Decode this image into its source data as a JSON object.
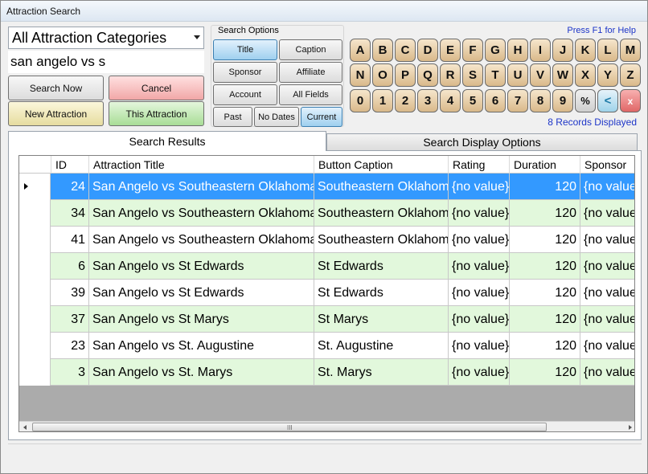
{
  "window": {
    "title": "Attraction Search"
  },
  "category_select": {
    "value": "All Attraction Categories"
  },
  "search": {
    "value": "san angelo vs s"
  },
  "actions": {
    "search_now": "Search Now",
    "cancel": "Cancel",
    "new_attraction": "New Attraction",
    "this_attraction": "This Attraction"
  },
  "search_options": {
    "legend": "Search Options",
    "title": "Title",
    "caption": "Caption",
    "sponsor": "Sponsor",
    "affiliate": "Affiliate",
    "account": "Account",
    "all_fields": "All Fields",
    "past": "Past",
    "no_dates": "No Dates",
    "current": "Current",
    "selected": [
      "Title",
      "Current"
    ]
  },
  "help_text": "Press F1 for Help",
  "keyboard": {
    "row1": [
      "A",
      "B",
      "C",
      "D",
      "E",
      "F",
      "G",
      "H",
      "I",
      "J",
      "K",
      "L",
      "M"
    ],
    "row2": [
      "N",
      "O",
      "P",
      "Q",
      "R",
      "S",
      "T",
      "U",
      "V",
      "W",
      "X",
      "Y",
      "Z"
    ],
    "row3": [
      "0",
      "1",
      "2",
      "3",
      "4",
      "5",
      "6",
      "7",
      "8",
      "9"
    ],
    "percent": "%",
    "backspace": "<",
    "clear": "x"
  },
  "records_text": "8 Records Displayed",
  "tabs": {
    "results": "Search Results",
    "display": "Search Display Options"
  },
  "grid": {
    "columns": [
      "ID",
      "Attraction Title",
      "Button Caption",
      "Rating",
      "Duration",
      "Sponsor"
    ],
    "rows": [
      {
        "id": "24",
        "title": "San Angelo vs Southeastern Oklahoma",
        "caption": "Southeastern Oklahom",
        "rating": "{no value}",
        "duration": "120",
        "sponsor": "{no value}"
      },
      {
        "id": "34",
        "title": "San Angelo vs Southeastern Oklahoma",
        "caption": "Southeastern Oklahom",
        "rating": "{no value}",
        "duration": "120",
        "sponsor": "{no value}"
      },
      {
        "id": "41",
        "title": "San Angelo vs Southeastern Oklahoma",
        "caption": "Southeastern Oklahom",
        "rating": "{no value}",
        "duration": "120",
        "sponsor": "{no value}"
      },
      {
        "id": "6",
        "title": "San Angelo vs St Edwards",
        "caption": "St Edwards",
        "rating": "{no value}",
        "duration": "120",
        "sponsor": "{no value}"
      },
      {
        "id": "39",
        "title": "San Angelo vs St Edwards",
        "caption": "St Edwards",
        "rating": "{no value}",
        "duration": "120",
        "sponsor": "{no value}"
      },
      {
        "id": "37",
        "title": "San Angelo vs St Marys",
        "caption": "St Marys",
        "rating": "{no value}",
        "duration": "120",
        "sponsor": "{no value}"
      },
      {
        "id": "23",
        "title": "San Angelo vs St. Augustine",
        "caption": "St. Augustine",
        "rating": "{no value}",
        "duration": "120",
        "sponsor": "{no value}"
      },
      {
        "id": "3",
        "title": "San Angelo vs St. Marys",
        "caption": "St. Marys",
        "rating": "{no value}",
        "duration": "120",
        "sponsor": "{no value}"
      }
    ],
    "scroll_grip": "III"
  },
  "colors": {
    "selected_row": "#3399ff",
    "alt_row": "#e2f8dc",
    "row": "#ffffff",
    "link_blue": "#1d35c8"
  }
}
